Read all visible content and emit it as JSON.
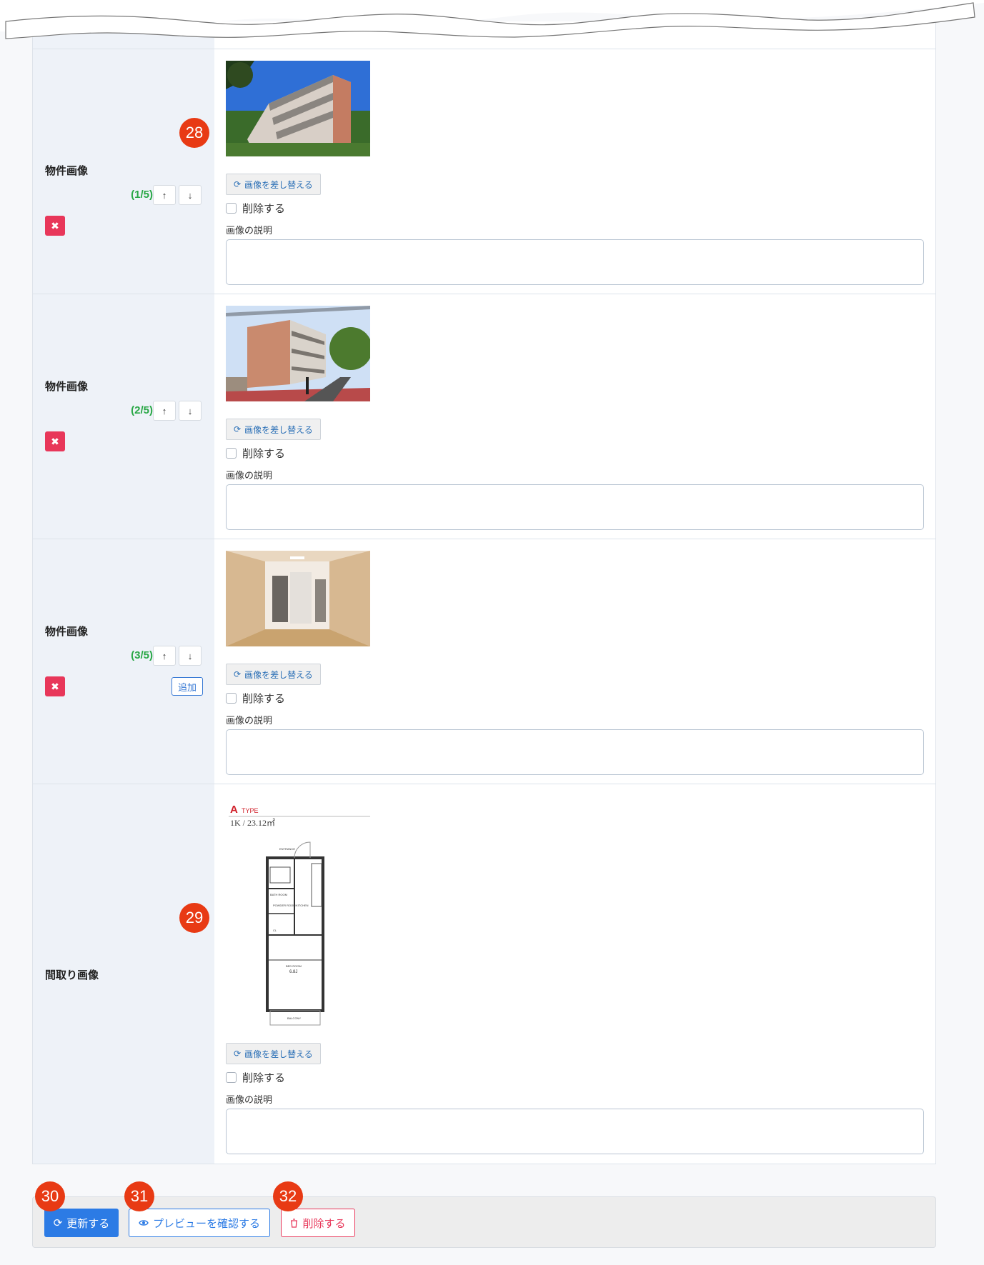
{
  "rows": [
    {
      "label": "物件画像",
      "order": "(1/5)",
      "replace_label": "画像を差し替える",
      "delete_check_label": "削除する",
      "caption_label": "画像の説明",
      "caption_value": ""
    },
    {
      "label": "物件画像",
      "order": "(2/5)",
      "replace_label": "画像を差し替える",
      "delete_check_label": "削除する",
      "caption_label": "画像の説明",
      "caption_value": ""
    },
    {
      "label": "物件画像",
      "order": "(3/5)",
      "add_label": "追加",
      "replace_label": "画像を差し替える",
      "delete_check_label": "削除する",
      "caption_label": "画像の説明",
      "caption_value": ""
    },
    {
      "label": "間取り画像",
      "replace_label": "画像を差し替える",
      "delete_check_label": "削除する",
      "caption_label": "画像の説明",
      "caption_value": ""
    }
  ],
  "floorplan": {
    "type_letter": "A",
    "type_word": "TYPE",
    "size": "1K / 23.12㎡",
    "entrance": "ENTRANCE",
    "bath": "BATH ROOM",
    "powder": "POWDER ROOM",
    "kitchen": "KITCHEN",
    "bedroom": "BED ROOM",
    "bedroom_size": "6.8J",
    "balcony": "BALCONY",
    "cl": "CL"
  },
  "badges": {
    "b28": "28",
    "b29": "29",
    "b30": "30",
    "b31": "31",
    "b32": "32"
  },
  "footer": {
    "update_label": "更新する",
    "preview_label": "プレビューを確認する",
    "delete_label": "削除する"
  },
  "colors": {
    "primary": "#2c7be5",
    "danger": "#e8375a",
    "success": "#28a745",
    "badge": "#e83a14"
  },
  "icons": {
    "up": "↑",
    "down": "↓",
    "close": "✖",
    "refresh": "⟳"
  }
}
